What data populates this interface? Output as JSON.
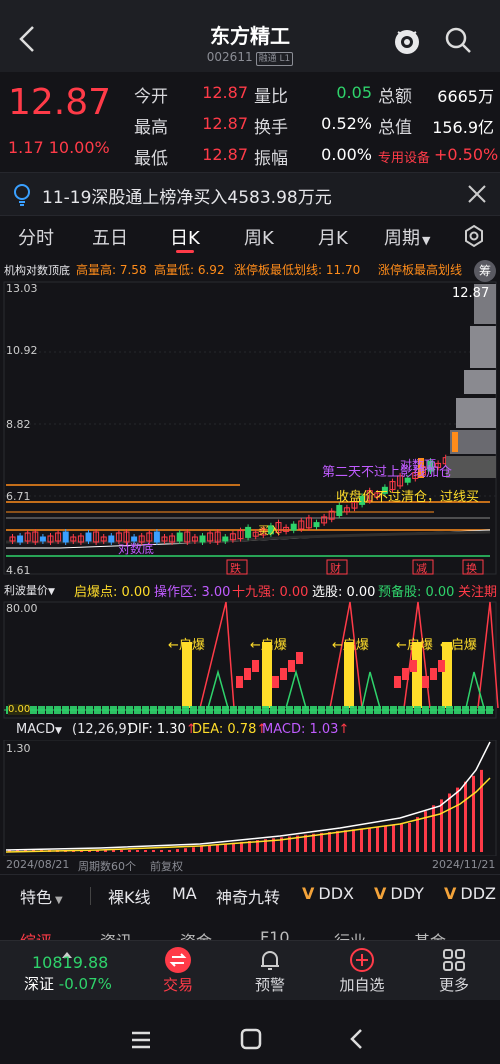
{
  "header": {
    "title": "东方精工",
    "code": "002611",
    "code_tag": "融通 L1"
  },
  "quote": {
    "price": "12.87",
    "change": "1.17",
    "change_pct": "10.00%",
    "rows": [
      {
        "l1": "今开",
        "v1": "12.87",
        "l2": "量比",
        "v2": "0.05",
        "l3": "总额",
        "v3": "6665万"
      },
      {
        "l1": "最高",
        "v1": "12.87",
        "l2": "换手",
        "v2": "0.52%",
        "l3": "总值",
        "v3": "156.9亿"
      },
      {
        "l1": "最低",
        "v1": "12.87",
        "l2": "振幅",
        "v2": "0.00%",
        "l3": "专用设备",
        "v3": "+0.50%"
      }
    ]
  },
  "news": {
    "text": "11-19深股通上榜净买入4583.98万元"
  },
  "tabs": [
    "分时",
    "五日",
    "日K",
    "周K",
    "月K",
    "周期"
  ],
  "kline": {
    "info_name": "机构对数顶底",
    "info_parts": [
      {
        "text": "高量高: 7.58",
        "color": "#ff8c1a"
      },
      {
        "text": "高量低: 6.92",
        "color": "#ff8c1a"
      },
      {
        "text": "涨停板最低划线: 11.70",
        "color": "#ff8c1a"
      },
      {
        "text": "涨停板最高划线",
        "color": "#ff8c1a"
      }
    ],
    "y_labels": [
      "13.03",
      "10.92",
      "8.82",
      "6.71",
      "4.61"
    ],
    "price_tag": "12.87",
    "badge": "筹",
    "annotations": {
      "a1": "第二天不过上影线加仓",
      "a2": "收盘价不过清仓，过线买",
      "a3": "对数顶",
      "a4": "对数底",
      "a5": "买入",
      "a6": "跌",
      "a7": "财",
      "a8": "减",
      "a9": "换"
    }
  },
  "indicator": {
    "name": "利波量价",
    "parts": [
      {
        "text": "启爆点: 0.00",
        "color": "#ffdd2a"
      },
      {
        "text": "操作区: 3.00",
        "color": "#c05cff"
      },
      {
        "text": "十九强: 0.00",
        "color": "#ff3b48"
      },
      {
        "text": "选股: 0.00",
        "color": "#ffffff"
      },
      {
        "text": "预备股: 0.00",
        "color": "#2fd36b"
      },
      {
        "text": "关注期",
        "color": "#ff3b48"
      }
    ],
    "y_top": "80.00",
    "y_bottom": "0.00",
    "burst_label": "←启爆"
  },
  "macd": {
    "name": "MACD",
    "params": "(12,26,9)",
    "dif": "DIF: 1.30",
    "dea": "DEA: 0.78",
    "macd": "MACD: 1.03",
    "y_top": "1.30"
  },
  "dates": {
    "start": "2024/08/21",
    "period_count": "周期数60个",
    "adjust": "前复权",
    "end": "2024/11/21"
  },
  "feature_bar": {
    "items": [
      "特色",
      "裸K线",
      "MA",
      "神奇九转",
      "DDX",
      "DDY",
      "DDZ"
    ]
  },
  "subtabs": [
    "综评",
    "资讯",
    "资金",
    "F10",
    "行业",
    "基金"
  ],
  "nav": {
    "index_value": "10819.88",
    "index_name": "深证",
    "index_change": "-0.07%",
    "items": [
      "交易",
      "预警",
      "加自选",
      "更多"
    ]
  },
  "colors": {
    "up": "#ff3b48",
    "down": "#2fd36b",
    "accent": "#ff3b48",
    "background": "#141418"
  }
}
